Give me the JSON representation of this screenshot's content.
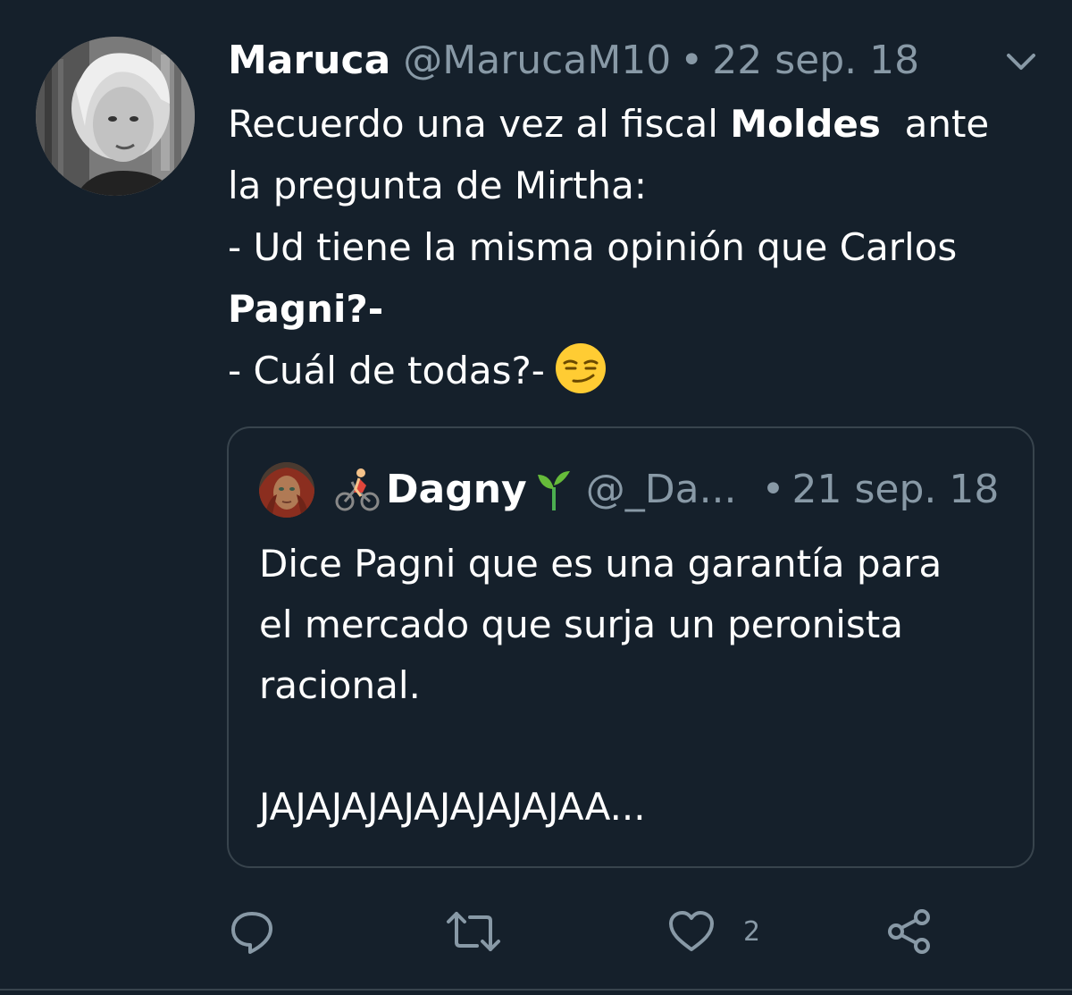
{
  "tweet": {
    "display_name": "Maruca",
    "handle": "@MarucaM10",
    "separator": "•",
    "date": "22 sep. 18",
    "lines": [
      {
        "parts": [
          "Recuerdo una vez al fiscal ",
          "Moldes",
          "  ante"
        ]
      },
      {
        "text": "la pregunta de Mirtha:"
      },
      {
        "text": "- Ud tiene la misma opinión que Carlos"
      },
      {
        "text": "Pagni?-"
      },
      {
        "text": "- Cuál de todas?-"
      }
    ],
    "emoji": "smirking-face"
  },
  "quoted_tweet": {
    "display_name": "Dagny",
    "name_prefix_icon": "person-biking-icon",
    "name_suffix_icon": "seedling-icon",
    "handle": "@_Da...",
    "separator": "•",
    "date": "21 sep. 18",
    "lines": [
      "Dice Pagni que es una garantía para",
      "el mercado que surja un peronista",
      "racional.",
      "",
      "JAJAJAJAJAJAJAJAJAA..."
    ]
  },
  "actions": {
    "reply_icon": "reply-icon",
    "retweet_icon": "retweet-icon",
    "like_icon": "heart-icon",
    "like_count": "2",
    "share_icon": "share-icon"
  },
  "colors": {
    "background": "#15202b",
    "text": "#ffffff",
    "muted": "#8899a6",
    "border": "#38444d"
  }
}
